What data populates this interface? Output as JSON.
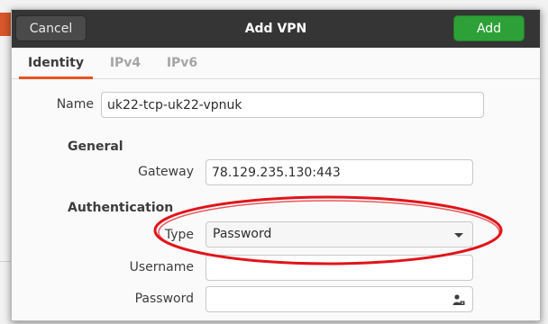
{
  "dialog": {
    "title": "Add VPN",
    "cancel_label": "Cancel",
    "add_label": "Add"
  },
  "tabs": [
    {
      "label": "Identity",
      "active": true
    },
    {
      "label": "IPv4",
      "active": false
    },
    {
      "label": "IPv6",
      "active": false
    }
  ],
  "form": {
    "name_label": "Name",
    "name_value": "uk22-tcp-uk22-vpnuk",
    "general_heading": "General",
    "gateway_label": "Gateway",
    "gateway_value": "78.129.235.130:443",
    "authentication_heading": "Authentication",
    "type_label": "Type",
    "type_value": "Password",
    "username_label": "Username",
    "username_value": "",
    "password_label": "Password",
    "password_value": ""
  },
  "icons": {
    "type_dropdown": "chevron-down-icon",
    "password_options": "user-key-icon"
  },
  "colors": {
    "titlebar": "#353535",
    "add_button": "#2ea038",
    "tab_accent": "#e95420",
    "annotation_ellipse": "#e0151b"
  }
}
